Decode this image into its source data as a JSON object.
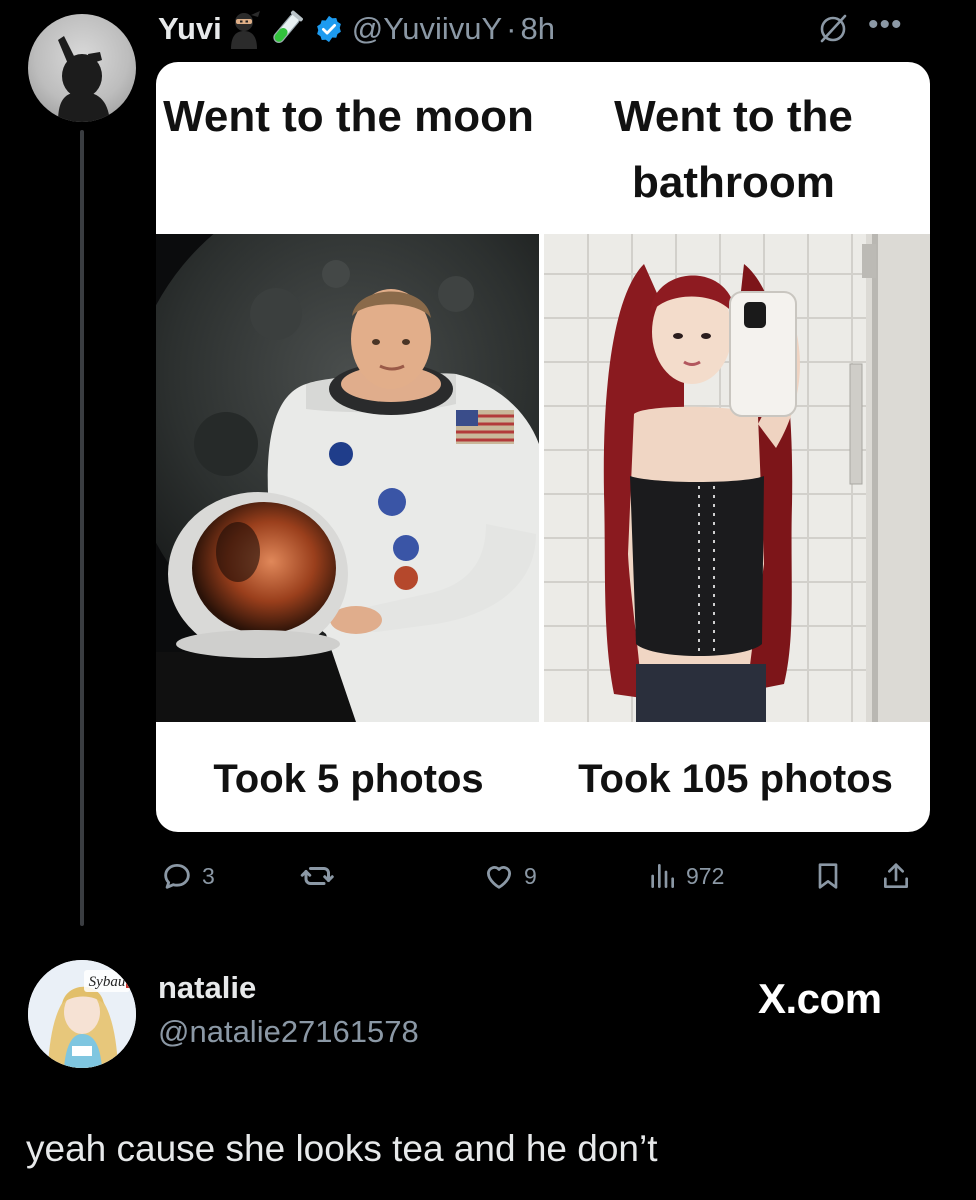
{
  "tweet": {
    "author": {
      "display_name": "Yuvi",
      "name_emojis": [
        "ninja-emoji",
        "test-tube-emoji"
      ],
      "handle": "@YuviivuY",
      "separator": "·",
      "time": "8h",
      "verified": true
    },
    "meme": {
      "top_left_caption": "Went to the moon",
      "top_right_caption": "Went to the bathroom",
      "bottom_left_caption": "Took 5 photos",
      "bottom_right_caption": "Took 105 photos"
    },
    "actions": {
      "replies": "3",
      "reposts": "",
      "likes": "9",
      "views": "972"
    }
  },
  "reply": {
    "display_name": "natalie",
    "handle": "@natalie27161578",
    "text": "yeah cause she looks tea and he don’t",
    "avatar_text": "Sybau"
  },
  "watermark": "X.com",
  "colors": {
    "background": "#000000",
    "primary_text": "#e7e9ea",
    "secondary_text": "#8b98a5",
    "verified_blue": "#1d9bf0",
    "thread_line": "#3a3d41"
  },
  "icons": {
    "verified": "verified-badge-icon",
    "grok": "grok-icon",
    "more": "more-dots-icon",
    "reply": "reply-icon",
    "repost": "repost-icon",
    "like": "heart-icon",
    "views": "views-chart-icon",
    "bookmark": "bookmark-icon",
    "share": "share-icon"
  }
}
